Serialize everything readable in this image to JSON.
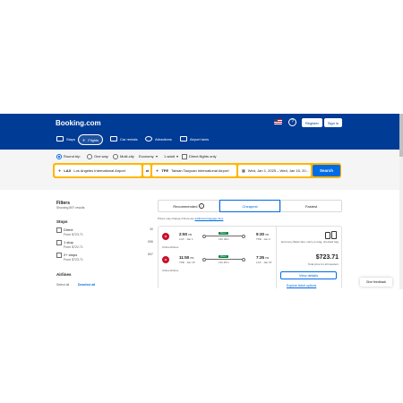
{
  "header": {
    "logo": "Booking.com",
    "register": "Register",
    "sign_in": "Sign in",
    "nav": [
      {
        "label": "Stays",
        "icon": "bed-icon"
      },
      {
        "label": "Flights",
        "icon": "plane-icon",
        "active": true
      },
      {
        "label": "Car rentals",
        "icon": "car-icon"
      },
      {
        "label": "Attractions",
        "icon": "attraction-icon"
      },
      {
        "label": "Airport taxis",
        "icon": "taxi-icon"
      }
    ]
  },
  "search": {
    "trip_types": [
      "Round trip",
      "One way",
      "Multi-city"
    ],
    "cabin": "Economy",
    "passengers": "1 adult",
    "direct_only": "Direct flights only",
    "from_code": "LAX",
    "from_name": "Los Angeles International Airport",
    "to_code": "TPE",
    "to_name": "Taiwan Taoyuan International Airport",
    "dates": "Wed, Jan 1, 2025 – Wed, Jan 15, 20...",
    "button": "Search"
  },
  "filters": {
    "title": "Filters",
    "results": "Showing 897 results",
    "stops_title": "Stops",
    "stops": [
      {
        "label": "Direct",
        "price": "From $723.71",
        "count": "30"
      },
      {
        "label": "1 stop",
        "price": "From $722.71",
        "count": "596"
      },
      {
        "label": "2+ stops",
        "price": "From $723.71",
        "count": "897"
      }
    ],
    "airlines_title": "Airlines",
    "select_all": "Select all",
    "deselect_all": "Deselect all"
  },
  "sort": {
    "tabs": [
      "Recommended",
      "Cheapest",
      "Fastest"
    ],
    "active": "Cheapest",
    "note_prefix": "Prices may change if there are",
    "note_link": "additional baggage fees"
  },
  "result": {
    "outbound": {
      "dep_time": "2:50",
      "dep_tz": "PM",
      "dep_info": "LAX · Jan 1",
      "arr_time": "9:30",
      "arr_tz": "PM",
      "arr_info": "TPE · Jan 2",
      "badge": "Direct",
      "duration": "14h 40m"
    },
    "airline1": "China Airlines",
    "return": {
      "dep_time": "11:50",
      "dep_tz": "PM",
      "dep_info": "TPE · Jan 15",
      "arr_time": "7:35",
      "arr_tz": "PM",
      "arr_info": "LAX · Jan 15",
      "badge": "Direct",
      "duration": "11h 45m"
    },
    "airline2": "China Airlines",
    "fare_note": "Economy Basic fare: carry-on bag, checked bag",
    "price": "$723.71",
    "price_note": "Total price for all travelers",
    "view_details": "View details",
    "explore": "Explore ticket options"
  },
  "feedback": "Give feedback"
}
